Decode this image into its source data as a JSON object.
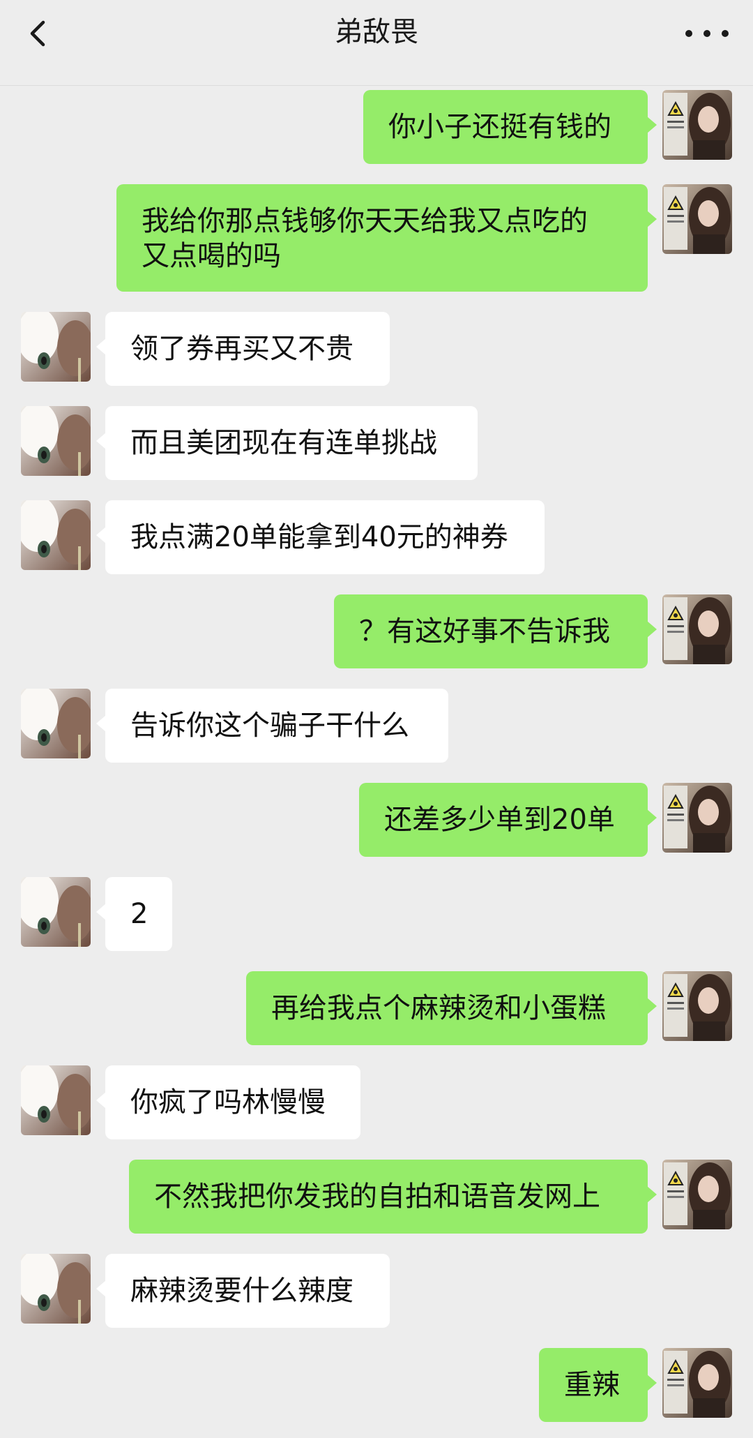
{
  "header": {
    "title": "弟敌畏",
    "back_icon": "chevron-left-icon",
    "more_icon": "more-horizontal-icon"
  },
  "colors": {
    "background": "#ededed",
    "sent_bubble": "#95ec69",
    "received_bubble": "#ffffff"
  },
  "messages": [
    {
      "sender": "me",
      "text": "你小子还挺有钱的"
    },
    {
      "sender": "me",
      "text": "我给你那点钱够你天天给我又点吃的\n又点喝的吗"
    },
    {
      "sender": "other",
      "text": "领了券再买又不贵"
    },
    {
      "sender": "other",
      "text": "而且美团现在有连单挑战"
    },
    {
      "sender": "other",
      "text": "我点满20单能拿到40元的神券"
    },
    {
      "sender": "me",
      "text": "？有这好事不告诉我"
    },
    {
      "sender": "other",
      "text": "告诉你这个骗子干什么"
    },
    {
      "sender": "me",
      "text": "还差多少单到20单"
    },
    {
      "sender": "other",
      "text": "2"
    },
    {
      "sender": "me",
      "text": "再给我点个麻辣烫和小蛋糕"
    },
    {
      "sender": "other",
      "text": "你疯了吗林慢慢"
    },
    {
      "sender": "me",
      "text": "不然我把你发我的自拍和语音发网上"
    },
    {
      "sender": "other",
      "text": "麻辣烫要什么辣度"
    },
    {
      "sender": "me",
      "text": "重辣"
    }
  ]
}
